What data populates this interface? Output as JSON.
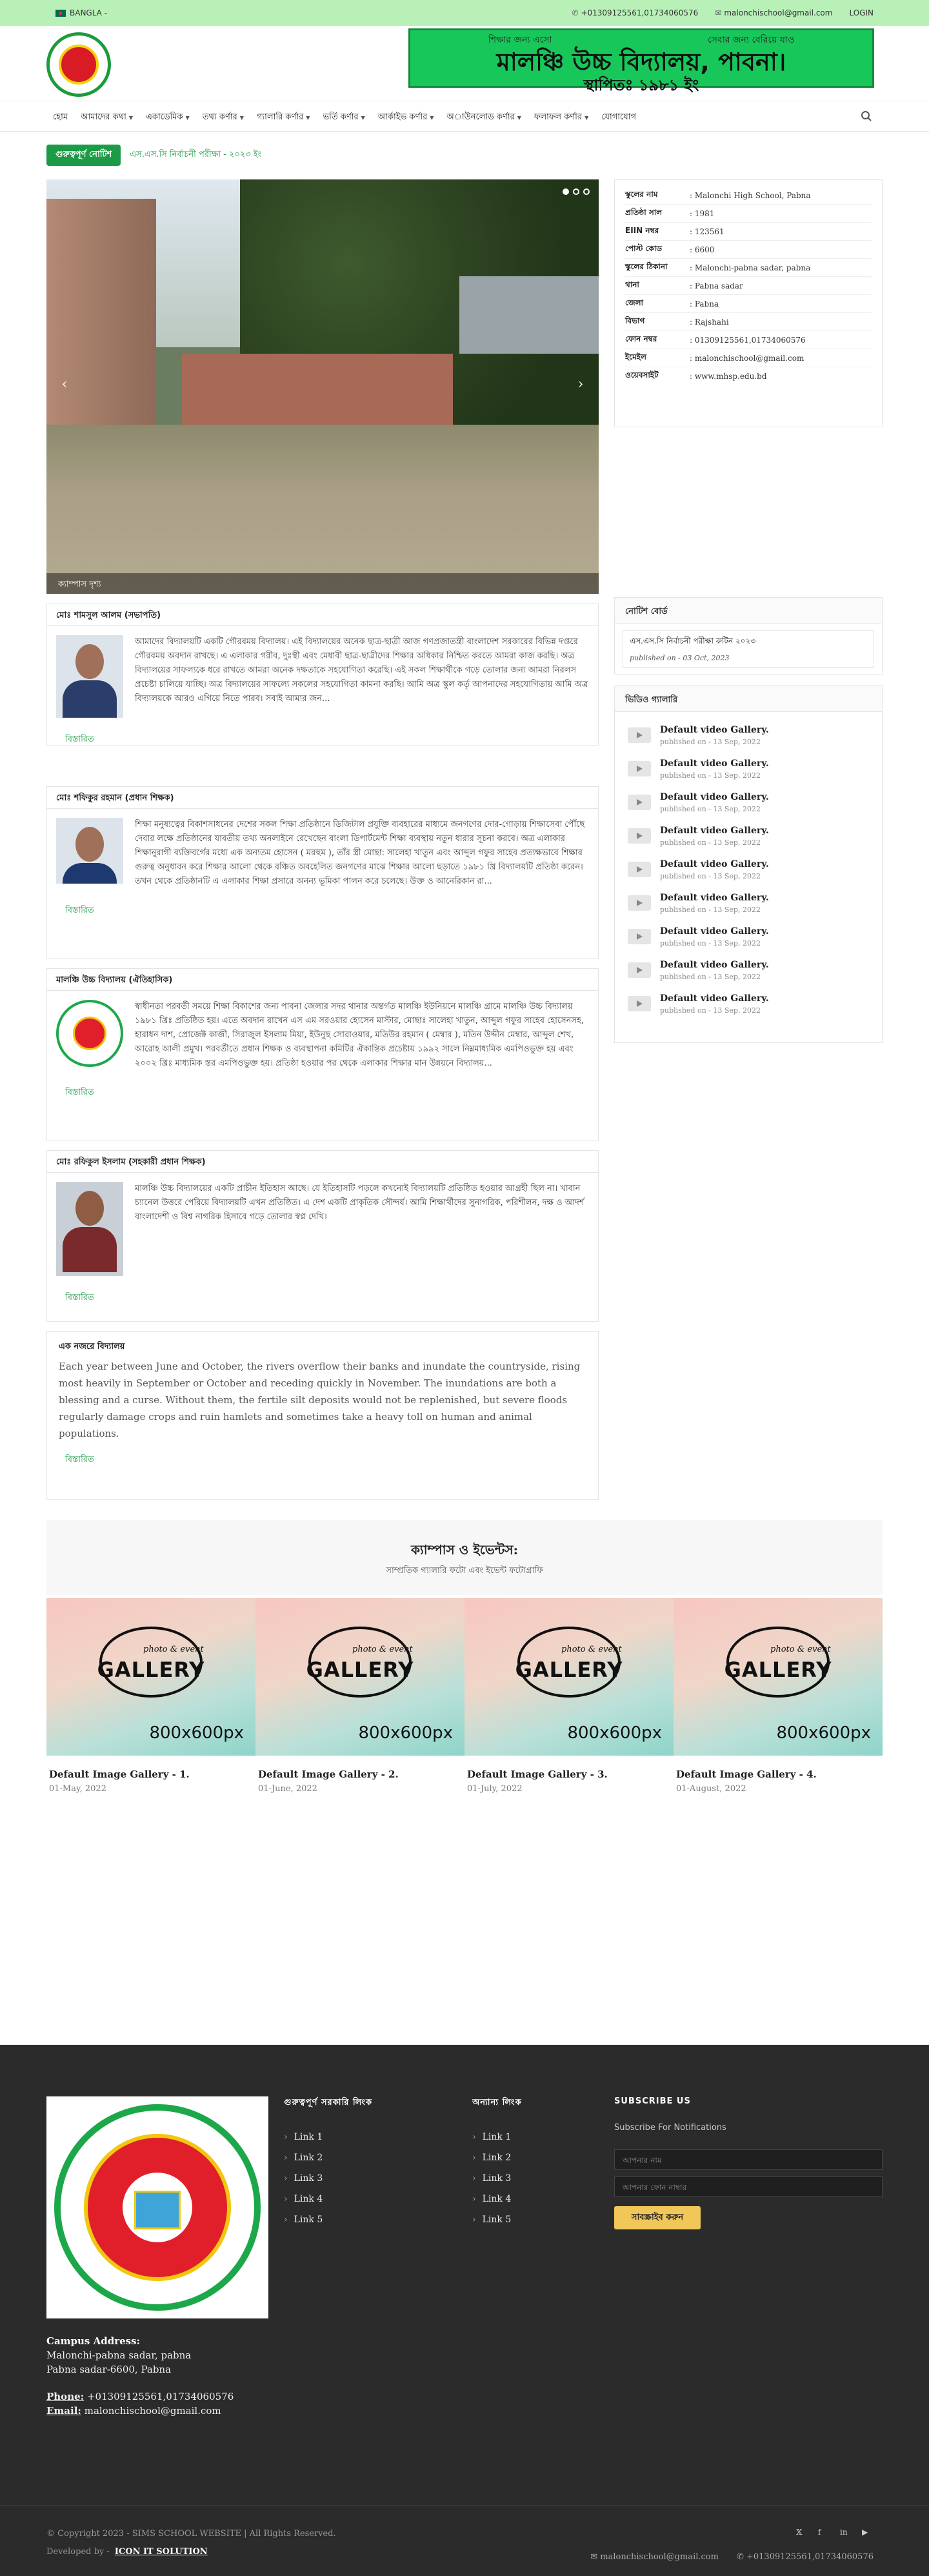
{
  "topbar": {
    "language": "BANGLA -",
    "phone": "+01309125561,01734060576",
    "email": "malonchischool@gmail.com",
    "login": "LOGIN"
  },
  "banner": {
    "line1_left": "শিক্ষার জন্য এসো",
    "line1_right": "সেবার জন্য বেরিয়ে যাও",
    "name": "মালঞ্চি উচ্চ বিদ্যালয়, পাবনা।",
    "established": "স্থাপিতঃ ১৯৮১ ইং"
  },
  "nav": [
    {
      "label": "হোম",
      "dd": false
    },
    {
      "label": "আমাদের কথা",
      "dd": true
    },
    {
      "label": "একাডেমিক",
      "dd": true
    },
    {
      "label": "তথ্য কর্ণার",
      "dd": true
    },
    {
      "label": "গ্যালারি কর্ণার",
      "dd": true
    },
    {
      "label": "ভর্তি কর্ণার",
      "dd": true
    },
    {
      "label": "আর্কাইভ কর্ণার",
      "dd": true
    },
    {
      "label": "অাউনলোড কর্ণার",
      "dd": true
    },
    {
      "label": "ফলাফল কর্ণার",
      "dd": true
    },
    {
      "label": "যোগাযোগ",
      "dd": false
    }
  ],
  "notice": {
    "label": "গুরুত্বপূর্ণ নোটিশ",
    "text": "এস.এস.সি নির্বাচনী পরীক্ষা - ২০২৩ ইং"
  },
  "slider": {
    "caption": "ক্যাম্পাস দৃশ্য",
    "prev": "‹",
    "next": "›"
  },
  "info": [
    {
      "k": "স্কুলের নাম",
      "v": ": Malonchi High School, Pabna"
    },
    {
      "k": "প্রতিষ্ঠা সাল",
      "v": ": 1981"
    },
    {
      "k": "EIIN নম্বর",
      "v": ": 123561"
    },
    {
      "k": "পোস্ট কোড",
      "v": ": 6600"
    },
    {
      "k": "স্কুলের ঠিকানা",
      "v": ": Malonchi-pabna sadar, pabna"
    },
    {
      "k": "থানা",
      "v": ": Pabna sadar"
    },
    {
      "k": "জেলা",
      "v": ": Pabna"
    },
    {
      "k": "বিভাগ",
      "v": ": Rajshahi"
    },
    {
      "k": "ফোন নম্বর",
      "v": ": 01309125561,01734060576"
    },
    {
      "k": "ইমেইল",
      "v": ": malonchischool@gmail.com"
    },
    {
      "k": "ওয়েবসাইট",
      "v": ": www.mhsp.edu.bd"
    }
  ],
  "cards": [
    {
      "title": "মোঃ শামসুল আলম (সভাপতি)",
      "text": "আমাদের বিদ্যালয়টি একটি গৌরবময় বিদ্যালয়। এই বিদ্যালয়ের অনেক ছাত্র-ছাত্রী আজ গণপ্রজাতন্ত্রী বাংলাদেশ সরকারের বিভিন্ন দপ্তরে গৌরবময় অবদান রাখছে। এ এলাকার গরীব, দুঃস্থী এবং মেধাবী ছাত্র-ছাত্রীদের শিক্ষার অধিকার নিশ্চিত করতে আমরা কাজ করছি। অত্র বিদ্যালয়ের সাফল্যকে ধরে রাখতে আমরা অনেক দক্ষতাকে সহযোগিতা করেছি। এই সকল শিক্ষার্থীকে গড়ে তোলার জন্য আমরা নিরলস প্রচেষ্টা চালিয়ে যাচ্ছি। অত্র বিদ্যালয়ের সাফল্যে সকলের সহযোগিতা কামনা করছি। আমি অত্র স্কুল কর্তৃ আপনাদের সহযোগিতায় আমি অত্র বিদ্যালয়কে আরও এগিয়ে নিতে পারব। সবাই আমার জন...",
      "more": "বিস্তারিত"
    },
    {
      "title": "মোঃ শফিকুর রহমান (প্রধান শিক্ষক)",
      "text": "শিক্ষা মনুষ্যত্বের বিকাশসাধনের দেশের সকল শিক্ষা প্রতিষ্ঠানে ডিজিটাল প্রযুক্তি ব্যবহারের মাধ্যমে জনগণের দোর-গোড়ায় শিক্ষাসেবা পৌঁছে দেবার লক্ষে প্রতিষ্ঠানের যাবতীয় তথ্য অনলাইনে রেখেছেন বাংলা ডিপার্টমেন্ট শিক্ষা ব্যবস্থায় নতুন ধারার সূচনা করবে। অত্র এলাকার শিক্ষানুরাগী ব্যক্তিবর্গের মধ্যে এক অন্যতম হোসেন ( মরহুম ), তাঁর স্ত্রী মোছা: সালেহা খাতুন এবং আব্দুল গফুর সাহেব প্রত্যক্ষভাবে শিক্ষার গুরুত্ব অনুধাবন করে শিক্ষার আলো থেকে বঞ্চিত অবহেলিত জনগণের মাঝে শিক্ষার আলো ছড়াতে ১৯৮১ খ্রি বিদ্যালয়টি প্রতিষ্ঠা করেন। তখন থেকে প্রতিষ্ঠানটি এ এলাকার শিক্ষা প্রসারে অনন্য ভূমিকা পালন করে চলেছে। উক্ত ও আনেরিকান রা...",
      "more": "বিস্তারিত"
    },
    {
      "title": "মালঞ্চি উচ্চ বিদ্যালয় (ঐতিহাসিক)",
      "text": "স্বাধীনতা পরবর্তী সময়ে শিক্ষা বিকাশের জন্য পাবনা জেলার সদর থানার অন্তর্গত মালঞ্চি ইউনিয়নে মালঞ্চি গ্রামে মালঞ্চি উচ্চ বিদ্যালয় ১৯৮১ খ্রিঃ প্রতিষ্ঠিত হয়। এতে অবদান রাখেন এস এম সরওয়ার হোসেন মাস্টার, মোছাঃ সালেহা খাতুন, আব্দুল গফুর সাহেব হোসেনসহ, হারাধন দাশ, প্রোজেক্ট কাজী, সিরাজুল ইসলাম মিয়া, ইউনুছ সোরাওয়ার, মতিউর রহমান ( মেম্বার ), মতিন উদ্দীন মেম্বার, আব্দুল শেখ, আরোহ আলী প্রমুখ। পরবর্তীতে প্রধান শিক্ষক ও ব্যবস্থাপনা কমিটির ঐকান্তিক প্রচেষ্টায় ১৯৯২ সালে নিম্নমাধ্যমিক এমপিওভুক্ত হয় এবং ২০০২ খ্রিঃ মাধ্যমিক স্তর এমপিওভুক্ত হয়। প্রতিষ্ঠা হওয়ার পর থেকে এলাকার শিক্ষার মান উন্নয়নে বিদ্যালয়...",
      "more": "বিস্তারিত"
    },
    {
      "title": "মোঃ রফিকুল ইসলাম (সহকারী প্রধান শিক্ষক)",
      "text": "মালঞ্চি উচ্চ বিদ্যালয়ের একটি প্রাচীন ইতিহাস আছে। যে ইতিহাসটি পড়লে কখনোই বিদ্যালয়টি প্রতিষ্ঠিত হওয়ার আগ্রহী ছিল না। খাবান চ্যানেল উত্তরে পেরিয়ে বিদ্যালয়টি এখন প্রতিষ্ঠিত। এ দেশ একটি প্রাকৃতিক সৌন্দর্য। আমি শিক্ষার্থীদের সুনাগরিক, পরিশীলন, দক্ষ ও আদর্শ বাংলাদেশী ও বিশ্ব নাগরিক হিসাবে গড়ে তোলার স্বপ্ন দেখি।",
      "more": "বিস্তারিত"
    },
    {
      "title": "এক নজরে বিদ্যালয়",
      "text": "Each year between June and October, the rivers overflow their banks and inundate the countryside, rising most heavily in September or October and receding quickly in November. The inundations are both a blessing and a curse. Without them, the fertile silt deposits would not be replenished, but severe floods regularly damage crops and ruin hamlets and sometimes take a heavy toll on human and animal populations.",
      "more": "বিস্তারিত"
    }
  ],
  "notice_widget": {
    "title": "নোটিশ বোর্ড",
    "item_title": "এস.এস.সি নির্বাচনী পরীক্ষা রুটিন ২০২৩",
    "item_date": "published on - 03 Oct, 2023"
  },
  "video_widget": {
    "title": "ভিডিও গ্যালারি",
    "items": [
      {
        "t": "Default video Gallery.",
        "d": "published on - 13 Sep, 2022"
      },
      {
        "t": "Default video Gallery.",
        "d": "published on - 13 Sep, 2022"
      },
      {
        "t": "Default video Gallery.",
        "d": "published on - 13 Sep, 2022"
      },
      {
        "t": "Default video Gallery.",
        "d": "published on - 13 Sep, 2022"
      },
      {
        "t": "Default video Gallery.",
        "d": "published on - 13 Sep, 2022"
      },
      {
        "t": "Default video Gallery.",
        "d": "published on - 13 Sep, 2022"
      },
      {
        "t": "Default video Gallery.",
        "d": "published on - 13 Sep, 2022"
      },
      {
        "t": "Default video Gallery.",
        "d": "published on - 13 Sep, 2022"
      },
      {
        "t": "Default video Gallery.",
        "d": "published on - 13 Sep, 2022"
      }
    ]
  },
  "gallery": {
    "title": "ক্যাম্পাস ও ইভেন্টস:",
    "subtitle": "সাম্প্রতিক গ্যালারি ফটো এবং ইভেন্ট ফটোগ্রাফি",
    "img_pe": "photo & event",
    "img_word": "GALLERY",
    "img_size": "800x600px",
    "items": [
      {
        "t": "Default Image Gallery - 1.",
        "d": "01-May, 2022"
      },
      {
        "t": "Default Image Gallery - 2.",
        "d": "01-June, 2022"
      },
      {
        "t": "Default Image Gallery - 3.",
        "d": "01-July, 2022"
      },
      {
        "t": "Default Image Gallery - 4.",
        "d": "01-August, 2022"
      }
    ]
  },
  "footer": {
    "campus_label": "Campus Address:",
    "campus_line1": "Malonchi-pabna sadar, pabna",
    "campus_line2": "Pabna sadar-6600, Pabna",
    "phone_label": "Phone:",
    "phone": " +01309125561,01734060576",
    "email_label": "Email:",
    "email": " malonchischool@gmail.com",
    "col1_title": "গুরুত্বপূর্ণ সরকারি লিংক",
    "col2_title": "অন্যান্য লিংক",
    "links1": [
      "Link 1",
      "Link 2",
      "Link 3",
      "Link 4",
      "Link 5"
    ],
    "links2": [
      "Link 1",
      "Link 2",
      "Link 3",
      "Link 4",
      "Link 5"
    ],
    "sub_title": "SUBSCRIBE US",
    "sub_text": "Subscribe For Notifications",
    "sub_name_ph": "আপনার নাম",
    "sub_email_ph": "আপনার ফোন নাম্বার",
    "sub_btn": "সাবস্ক্রাইব করুন",
    "copyright": "© Copyright 2023 - SIMS SCHOOL WEBSITE | All Rights Reserved.",
    "dev_label": "Developed by -",
    "dev_name": "ICON IT SOLUTION",
    "bot_email": "malonchischool@gmail.com",
    "bot_phone": "+01309125561,01734060576"
  }
}
